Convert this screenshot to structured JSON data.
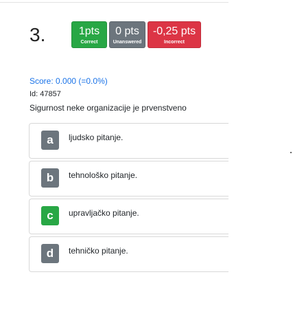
{
  "question": {
    "number": "3.",
    "badges": {
      "correct": {
        "value": "1pts",
        "caption": "Correct",
        "color": "#28a745"
      },
      "unanswered": {
        "value": "0 pts",
        "caption": "Unanswered",
        "color": "#6c757d"
      },
      "incorrect": {
        "value": "-0,25 pts",
        "caption": "Incorrect",
        "color": "#dc3545"
      }
    },
    "score": "Score: 0.000 (=0.0%)",
    "id": "Id: 47857",
    "text": "Sigurnost neke organizacije je prvenstveno",
    "answers": [
      {
        "letter": "a",
        "text": "ljudsko pitanje.",
        "highlight": false
      },
      {
        "letter": "b",
        "text": "tehnološko pitanje.",
        "highlight": false
      },
      {
        "letter": "c",
        "text": "upravljačko pitanje.",
        "highlight": true
      },
      {
        "letter": "d",
        "text": "tehničko pitanje.",
        "highlight": false
      }
    ]
  }
}
